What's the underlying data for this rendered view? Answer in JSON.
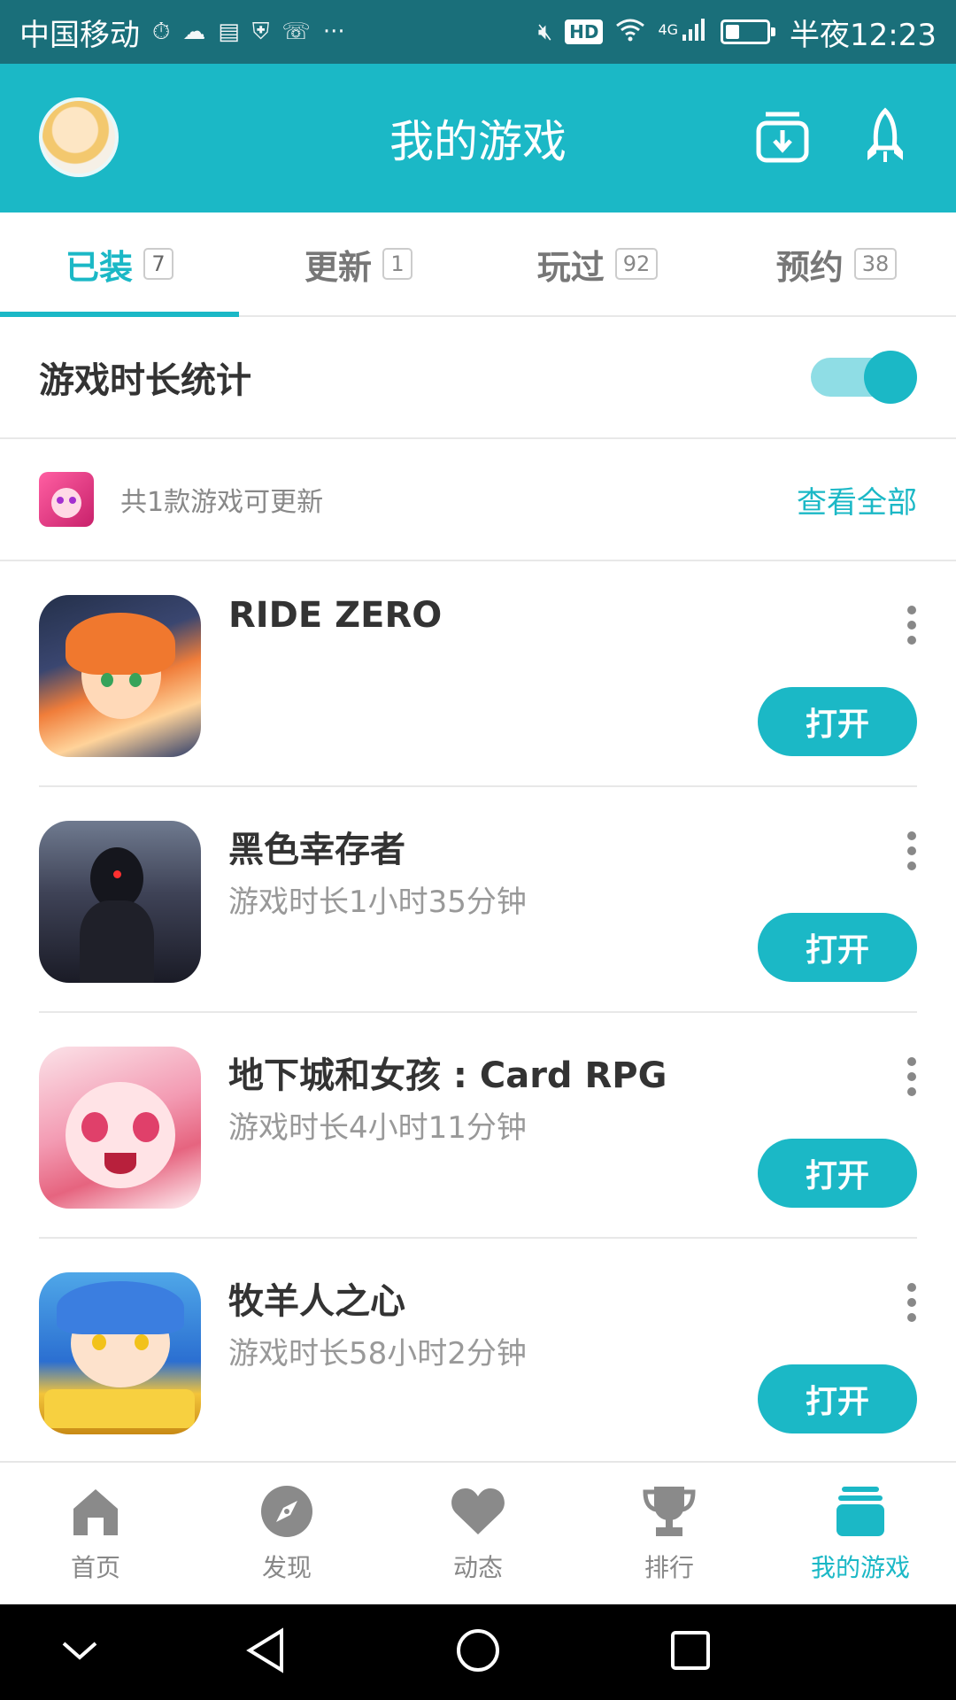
{
  "status_bar": {
    "carrier": "中国移动",
    "hd_label": "HD",
    "network": "4G",
    "time": "半夜12:23",
    "battery_level": 0.35
  },
  "header": {
    "title": "我的游戏",
    "icons": [
      "avatar",
      "download-icon",
      "rocket-icon"
    ]
  },
  "tabs": [
    {
      "label": "已装",
      "count": "7"
    },
    {
      "label": "更新",
      "count": "1"
    },
    {
      "label": "玩过",
      "count": "92"
    },
    {
      "label": "预约",
      "count": "38"
    }
  ],
  "stats": {
    "label": "游戏时长统计",
    "enabled": true
  },
  "update_notice": {
    "text": "共1款游戏可更新",
    "link": "查看全部"
  },
  "games": [
    {
      "name": "RIDE ZERO",
      "playtime": "",
      "button": "打开"
    },
    {
      "name": "黑色幸存者",
      "playtime": "游戏时长1小时35分钟",
      "button": "打开"
    },
    {
      "name": "地下城和女孩 : Card RPG",
      "playtime": "游戏时长4小时11分钟",
      "button": "打开"
    },
    {
      "name": "牧羊人之心",
      "playtime": "游戏时长58小时2分钟",
      "button": "打开"
    }
  ],
  "bottom_nav": [
    {
      "label": "首页",
      "icon": "home-icon"
    },
    {
      "label": "发现",
      "icon": "compass-icon"
    },
    {
      "label": "动态",
      "icon": "heart-icon"
    },
    {
      "label": "排行",
      "icon": "trophy-icon"
    },
    {
      "label": "我的游戏",
      "icon": "game-stack-icon"
    }
  ],
  "colors": {
    "accent": "#1bb8c6",
    "status_bar": "#1a6f7a"
  }
}
